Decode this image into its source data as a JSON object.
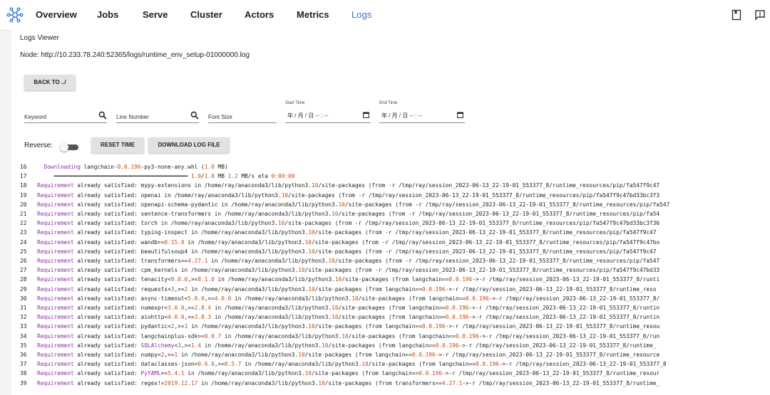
{
  "nav": {
    "items": [
      {
        "label": "Overview",
        "active": false
      },
      {
        "label": "Jobs",
        "active": false
      },
      {
        "label": "Serve",
        "active": false
      },
      {
        "label": "Cluster",
        "active": false
      },
      {
        "label": "Actors",
        "active": false
      },
      {
        "label": "Metrics",
        "active": false
      },
      {
        "label": "Logs",
        "active": true
      }
    ],
    "icons": [
      "docs-icon",
      "feedback-icon"
    ],
    "accent_color": "#2f7ad8"
  },
  "viewer": {
    "title": "Logs Viewer",
    "node_text": "Node: http://10.233.78.240:52365/logs/runtime_env_setup-01000000.log",
    "back_label": "BACK TO ../",
    "filters": {
      "keyword_placeholder": "Keyword",
      "line_number_placeholder": "Line Number",
      "font_size_placeholder": "Font Size",
      "start_time_label": "Start Time",
      "end_time_label": "End Time",
      "start_time_value": "年 / 月 / 日  -- : --",
      "end_time_value": "年 / 月 / 日  -- : --"
    },
    "reverse_label": "Reverse:",
    "reverse_on": false,
    "reset_time_label": "RESET TIME",
    "download_label": "DOWNLOAD LOG FILE"
  },
  "log_lines": [
    {
      "n": "16",
      "segs": [
        [
          "txt",
          "  "
        ],
        [
          "req",
          "Downloading"
        ],
        [
          "txt",
          " langchain-"
        ],
        [
          "ver",
          "0.0.196"
        ],
        [
          "txt",
          "-py3-none-any.whl ("
        ],
        [
          "ver",
          "1.0"
        ],
        [
          "txt",
          " MB)"
        ]
      ]
    },
    {
      "n": "17",
      "segs": [
        [
          "txt",
          "     ━━━━━━━━━━━━━━━━━━━━━━━━━━━━━━━━━━━━━━━━ "
        ],
        [
          "ver",
          "1.0"
        ],
        [
          "txt",
          "/"
        ],
        [
          "ver",
          "1.0"
        ],
        [
          "txt",
          " MB "
        ],
        [
          "ver",
          "1.2"
        ],
        [
          "txt",
          " MB/s eta "
        ],
        [
          "ver",
          "0:00:00"
        ]
      ]
    },
    {
      "n": "18",
      "segs": [
        [
          "req",
          "Requirement"
        ],
        [
          "txt",
          " already satisfied: mypy-extensions in /home/ray/anaconda3/lib/python3."
        ],
        [
          "ver",
          "10"
        ],
        [
          "txt",
          "/site-packages (from -r /tmp/ray/session_2023-06-13_22-19-01_553377_8/runtime_resources/pip/fa547f9c47"
        ]
      ]
    },
    {
      "n": "19",
      "segs": [
        [
          "req",
          "Requirement"
        ],
        [
          "txt",
          " already satisfied: openai in /home/ray/anaconda3/lib/python3."
        ],
        [
          "ver",
          "10"
        ],
        [
          "txt",
          "/site-packages (from -r /tmp/ray/session_2023-06-13_22-19-01_553377_8/runtime_resources/pip/fa547f9c47bd33bc3f3"
        ]
      ]
    },
    {
      "n": "20",
      "segs": [
        [
          "req",
          "Requirement"
        ],
        [
          "txt",
          " already satisfied: openapi-schema-pydantic in /home/ray/anaconda3/lib/python3."
        ],
        [
          "ver",
          "10"
        ],
        [
          "txt",
          "/site-packages (from -r /tmp/ray/session_2023-06-13_22-19-01_553377_8/runtime_resources/pip/fa547"
        ]
      ]
    },
    {
      "n": "21",
      "segs": [
        [
          "req",
          "Requirement"
        ],
        [
          "txt",
          " already satisfied: sentence-transformers in /home/ray/anaconda3/lib/python3."
        ],
        [
          "ver",
          "10"
        ],
        [
          "txt",
          "/site-packages (from -r /tmp/ray/session_2023-06-13_22-19-01_553377_8/runtime_resources/pip/fa54"
        ]
      ]
    },
    {
      "n": "22",
      "segs": [
        [
          "req",
          "Requirement"
        ],
        [
          "txt",
          " already satisfied: torch in /home/ray/anaconda3/lib/python3."
        ],
        [
          "ver",
          "10"
        ],
        [
          "txt",
          "/site-packages (from -r /tmp/ray/session_2023-06-13_22-19-01_553377_8/runtime_resources/pip/fa547f9c47bd33bc3f36"
        ]
      ]
    },
    {
      "n": "23",
      "segs": [
        [
          "req",
          "Requirement"
        ],
        [
          "txt",
          " already satisfied: typing-inspect in /home/ray/anaconda3/lib/python3."
        ],
        [
          "ver",
          "10"
        ],
        [
          "txt",
          "/site-packages (from -r /tmp/ray/session_2023-06-13_22-19-01_553377_8/runtime_resources/pip/fa547f9c47"
        ]
      ]
    },
    {
      "n": "24",
      "segs": [
        [
          "req",
          "Requirement"
        ],
        [
          "txt",
          " already satisfied: wandb>="
        ],
        [
          "ver",
          "0.15.0"
        ],
        [
          "txt",
          " in /home/ray/anaconda3/lib/python3."
        ],
        [
          "ver",
          "10"
        ],
        [
          "txt",
          "/site-packages (from -r /tmp/ray/session_2023-06-13_22-19-01_553377_8/runtime_resources/pip/fa547f9c47bo"
        ]
      ]
    },
    {
      "n": "25",
      "segs": [
        [
          "req",
          "Requirement"
        ],
        [
          "txt",
          " already satisfied: beautifulsoup4 in /home/ray/anaconda3/lib/python3."
        ],
        [
          "ver",
          "10"
        ],
        [
          "txt",
          "/site-packages (from -r /tmp/ray/session_2023-06-13_22-19-01_553377_8/runtime_resources/pip/fa547f9c47"
        ]
      ]
    },
    {
      "n": "26",
      "segs": [
        [
          "req",
          "Requirement"
        ],
        [
          "txt",
          " already satisfied: transformers=="
        ],
        [
          "ver",
          "4.27.1"
        ],
        [
          "txt",
          " in /home/ray/anaconda3/lib/python3."
        ],
        [
          "ver",
          "10"
        ],
        [
          "txt",
          "/site-packages (from -r /tmp/ray/session_2023-06-13_22-19-01_553377_8/runtime_resources/pip/fa547"
        ]
      ]
    },
    {
      "n": "27",
      "segs": [
        [
          "req",
          "Requirement"
        ],
        [
          "txt",
          " already satisfied: cpm_kernels in /home/ray/anaconda3/lib/python3."
        ],
        [
          "ver",
          "10"
        ],
        [
          "txt",
          "/site-packages (from -r /tmp/ray/session_2023-06-13_22-19-01_553377_8/runtime_resources/pip/fa547f9c47bd33"
        ]
      ]
    },
    {
      "n": "28",
      "segs": [
        [
          "req",
          "Requirement"
        ],
        [
          "txt",
          " already satisfied: tenacity<"
        ],
        [
          "ver",
          "9.0.0"
        ],
        [
          "txt",
          ",>="
        ],
        [
          "ver",
          "8.1.0"
        ],
        [
          "txt",
          " in /home/ray/anaconda3/lib/python3."
        ],
        [
          "ver",
          "10"
        ],
        [
          "txt",
          "/site-packages (from langchain=="
        ],
        [
          "ver",
          "0.0.196"
        ],
        [
          "txt",
          "->-r /tmp/ray/session_2023-06-13_22-19-01_553377_8/runti"
        ]
      ]
    },
    {
      "n": "29",
      "segs": [
        [
          "req",
          "Requirement"
        ],
        [
          "txt",
          " already satisfied: requests<"
        ],
        [
          "ver",
          "3"
        ],
        [
          "txt",
          ",>="
        ],
        [
          "ver",
          "2"
        ],
        [
          "txt",
          " in /home/ray/anaconda3/lib/python3."
        ],
        [
          "ver",
          "10"
        ],
        [
          "txt",
          "/site-packages (from langchain=="
        ],
        [
          "ver",
          "0.0.196"
        ],
        [
          "txt",
          "->-r /tmp/ray/session_2023-06-13_22-19-01_553377_8/runtime_reso"
        ]
      ]
    },
    {
      "n": "30",
      "segs": [
        [
          "req",
          "Requirement"
        ],
        [
          "txt",
          " already satisfied: async-timeout<"
        ],
        [
          "ver",
          "5.0.0"
        ],
        [
          "txt",
          ",>="
        ],
        [
          "ver",
          "4.0.0"
        ],
        [
          "txt",
          " in /home/ray/anaconda3/lib/python3."
        ],
        [
          "ver",
          "10"
        ],
        [
          "txt",
          "/site-packages (from langchain=="
        ],
        [
          "ver",
          "0.0.196"
        ],
        [
          "txt",
          "->-r /tmp/ray/session_2023-06-13_22-19-01_553377_8/"
        ]
      ]
    },
    {
      "n": "31",
      "segs": [
        [
          "req",
          "Requirement"
        ],
        [
          "txt",
          " already satisfied: numexpr<"
        ],
        [
          "ver",
          "3.0.0"
        ],
        [
          "txt",
          ",>="
        ],
        [
          "ver",
          "2.8.4"
        ],
        [
          "txt",
          " in /home/ray/anaconda3/lib/python3."
        ],
        [
          "ver",
          "10"
        ],
        [
          "txt",
          "/site-packages (from langchain=="
        ],
        [
          "ver",
          "0.0.196"
        ],
        [
          "txt",
          "->-r /tmp/ray/session_2023-06-13_22-19-01_553377_8/runtin"
        ]
      ]
    },
    {
      "n": "32",
      "segs": [
        [
          "req",
          "Requirement"
        ],
        [
          "txt",
          " already satisfied: aiohttp<"
        ],
        [
          "ver",
          "4.0.0"
        ],
        [
          "txt",
          ",>="
        ],
        [
          "ver",
          "3.8.3"
        ],
        [
          "txt",
          " in /home/ray/anaconda3/lib/python3."
        ],
        [
          "ver",
          "10"
        ],
        [
          "txt",
          "/site-packages (from langchain=="
        ],
        [
          "ver",
          "0.0.196"
        ],
        [
          "txt",
          "->-r /tmp/ray/session_2023-06-13_22-19-01_553377_8/runtin"
        ]
      ]
    },
    {
      "n": "33",
      "segs": [
        [
          "req",
          "Requirement"
        ],
        [
          "txt",
          " already satisfied: pydantic<"
        ],
        [
          "ver",
          "2"
        ],
        [
          "txt",
          ",>="
        ],
        [
          "ver",
          "1"
        ],
        [
          "txt",
          " in /home/ray/anaconda3/lib/python3."
        ],
        [
          "ver",
          "10"
        ],
        [
          "txt",
          "/site-packages (from langchain=="
        ],
        [
          "ver",
          "0.0.196"
        ],
        [
          "txt",
          "->-r /tmp/ray/session_2023-06-13_22-19-01_553377_8/runtime_resou"
        ]
      ]
    },
    {
      "n": "34",
      "segs": [
        [
          "req",
          "Requirement"
        ],
        [
          "txt",
          " already satisfied: langchainplus-sdk>="
        ],
        [
          "ver",
          "0.0.7"
        ],
        [
          "txt",
          " in /home/ray/anaconda3/lib/python3."
        ],
        [
          "ver",
          "10"
        ],
        [
          "txt",
          "/site-packages (from langchain=="
        ],
        [
          "ver",
          "0.0.196"
        ],
        [
          "txt",
          "->-r /tmp/ray/session_2023-06-13_22-19-01_553377_8/run"
        ]
      ]
    },
    {
      "n": "35",
      "segs": [
        [
          "req",
          "Requirement"
        ],
        [
          "txt",
          " already satisfied: "
        ],
        [
          "req",
          "SQLAlchemy"
        ],
        [
          "txt",
          "<"
        ],
        [
          "ver",
          "3"
        ],
        [
          "txt",
          ",>="
        ],
        [
          "ver",
          "1.4"
        ],
        [
          "txt",
          " in /home/ray/anaconda3/lib/python3."
        ],
        [
          "ver",
          "10"
        ],
        [
          "txt",
          "/site-packages (from langchain=="
        ],
        [
          "ver",
          "0.0.196"
        ],
        [
          "txt",
          "->-r /tmp/ray/session_2023-06-13_22-19-01_553377_8/runtime_"
        ]
      ]
    },
    {
      "n": "36",
      "segs": [
        [
          "req",
          "Requirement"
        ],
        [
          "txt",
          " already satisfied: numpy<"
        ],
        [
          "ver",
          "2"
        ],
        [
          "txt",
          ",>="
        ],
        [
          "ver",
          "1"
        ],
        [
          "txt",
          " in /home/ray/anaconda3/lib/python3."
        ],
        [
          "ver",
          "10"
        ],
        [
          "txt",
          "/site-packages (from langchain=="
        ],
        [
          "ver",
          "0.0.196"
        ],
        [
          "txt",
          "->-r /tmp/ray/session_2023-06-13_22-19-01_553377_8/runtime_resource"
        ]
      ]
    },
    {
      "n": "37",
      "segs": [
        [
          "req",
          "Requirement"
        ],
        [
          "txt",
          " already satisfied: dataclasses-json<"
        ],
        [
          "ver",
          "0.6.0"
        ],
        [
          "txt",
          ",>="
        ],
        [
          "ver",
          "0.5.7"
        ],
        [
          "txt",
          " in /home/ray/anaconda3/lib/python3."
        ],
        [
          "ver",
          "10"
        ],
        [
          "txt",
          "/site-packages (from langchain=="
        ],
        [
          "ver",
          "0.0.196"
        ],
        [
          "txt",
          "->-r /tmp/ray/session_2023-06-13_22-19-01_553377_8"
        ]
      ]
    },
    {
      "n": "38",
      "segs": [
        [
          "req",
          "Requirement"
        ],
        [
          "txt",
          " already satisfied: "
        ],
        [
          "req",
          "PyYAML"
        ],
        [
          "txt",
          ">="
        ],
        [
          "ver",
          "5.4.1"
        ],
        [
          "txt",
          " in /home/ray/anaconda3/lib/python3."
        ],
        [
          "ver",
          "10"
        ],
        [
          "txt",
          "/site-packages (from langchain=="
        ],
        [
          "ver",
          "0.0.196"
        ],
        [
          "txt",
          "->-r /tmp/ray/session_2023-06-13_22-19-01_553377_8/runtime_resour"
        ]
      ]
    },
    {
      "n": "39",
      "segs": [
        [
          "req",
          "Requirement"
        ],
        [
          "txt",
          " already satisfied: regex!="
        ],
        [
          "ver",
          "2019.12.17"
        ],
        [
          "txt",
          " in /home/ray/anaconda3/lib/python3."
        ],
        [
          "ver",
          "10"
        ],
        [
          "txt",
          "/site-packages (from transformers=="
        ],
        [
          "ver",
          "4.27.1"
        ],
        [
          "txt",
          "->-r /tmp/ray/session_2023-06-13_22-19-01_553377_8/runtime_"
        ]
      ]
    }
  ]
}
